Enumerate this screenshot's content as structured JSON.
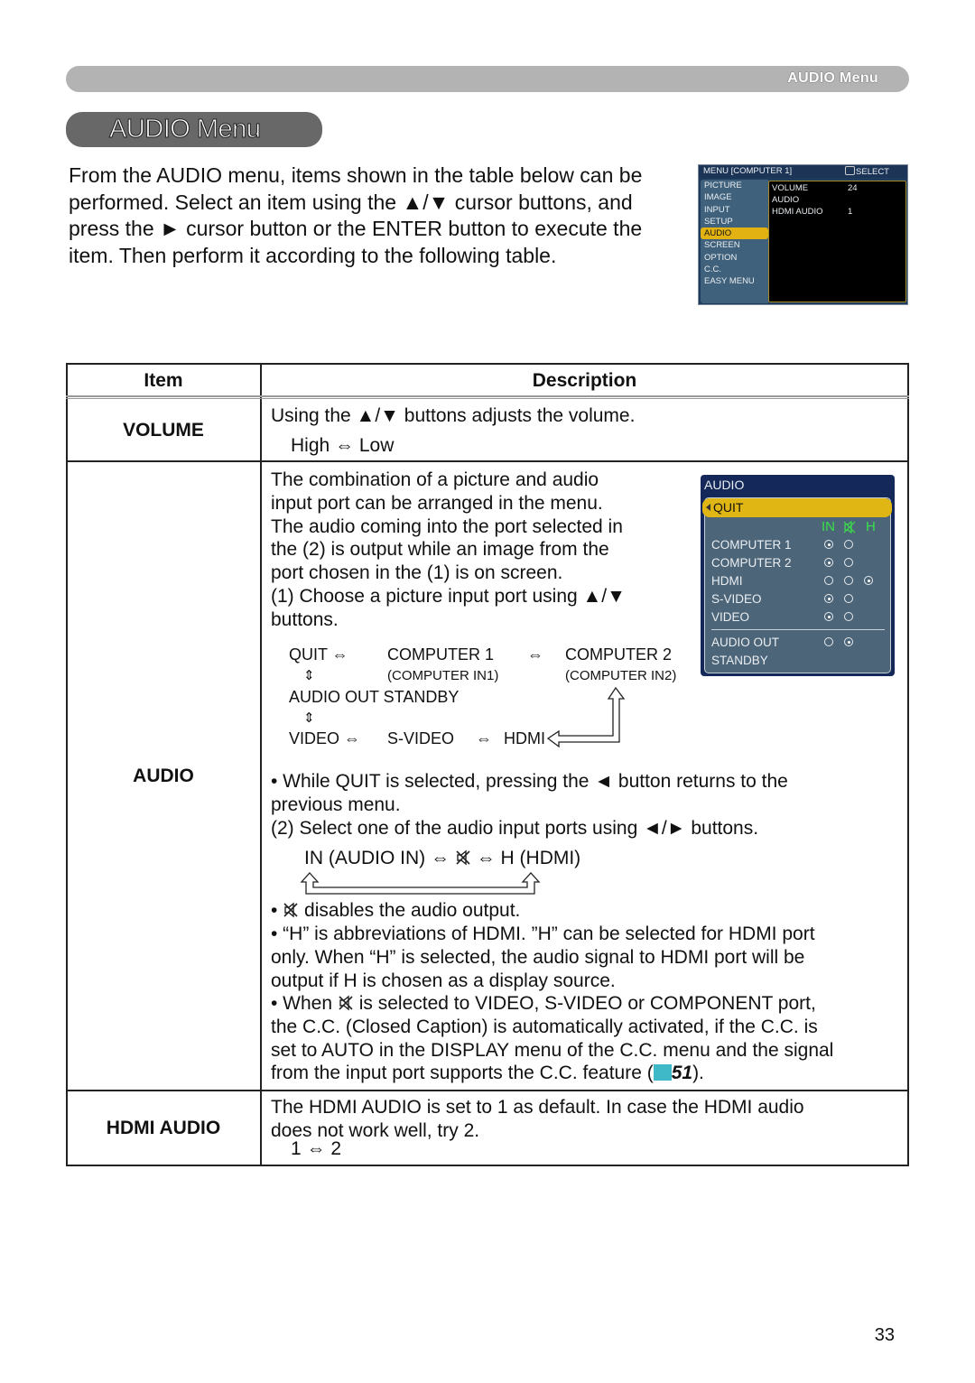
{
  "header": {
    "section_label": "AUDIO Menu"
  },
  "title": "AUDIO Menu",
  "intro": "From the AUDIO menu, items shown in the table below can be performed. Select an item using the ▲/▼ cursor buttons, and press the ► cursor button or the ENTER button to execute the item. Then perform it according to the following table.",
  "projector_menu": {
    "title": "MENU [COMPUTER 1]",
    "select_hint": "SELECT",
    "sidebar": [
      "PICTURE",
      "IMAGE",
      "INPUT",
      "SETUP",
      "AUDIO",
      "SCREEN",
      "OPTION",
      "C.C.",
      "EASY MENU"
    ],
    "selected": "AUDIO",
    "items": [
      {
        "label": "VOLUME",
        "value": "24"
      },
      {
        "label": "AUDIO",
        "value": ""
      },
      {
        "label": "HDMI AUDIO",
        "value": "1"
      }
    ],
    "colors": {
      "highlight": "#e2b212",
      "background": "#000000",
      "sidebar": "#40617b"
    }
  },
  "table": {
    "headers": {
      "item": "Item",
      "description": "Description"
    },
    "volume": {
      "item": "VOLUME",
      "line1": "Using the ▲/▼ buttons adjusts the volume.",
      "line2": "High ⇔ Low"
    },
    "audio": {
      "item": "AUDIO",
      "p1": [
        "The combination of a picture and audio",
        "input port can be arranged in the menu.",
        "The audio coming into the port selected in",
        "the (2) is output while an image from the",
        "port chosen in the (1) is on screen.",
        "(1) Choose a picture input port using ▲/▼",
        "buttons."
      ],
      "flow": {
        "quit": "QUIT ⇔",
        "computer1": "COMPUTER 1",
        "arrow1": "⇔",
        "computer2": "COMPUTER 2",
        "computer_in1": "(COMPUTER IN1)",
        "computer_in2": "(COMPUTER IN2)",
        "updown": "⇕",
        "audio_out_standby": "AUDIO OUT STANDBY",
        "video": "VIDEO ⇔",
        "svideo": "S-VIDEO",
        "arrow2": "⇔",
        "hdmi": "HDMI"
      },
      "p2": [
        "• While QUIT is selected, pressing the ◄ button returns to the",
        "previous menu.",
        "(2) Select one of the audio input ports using ◄/► buttons."
      ],
      "audio_flow": {
        "in": "IN (AUDIO IN) ⇔",
        "arrow": "⇔",
        "h": "H (HDMI)"
      },
      "notes": {
        "mute_prefix": "•",
        "mute_text": "disables the audio output.",
        "h_lines": [
          "• “H” is abbreviations of HDMI. ”H” can be selected for HDMI port",
          "only. When “H” is selected, the audio signal to HDMI port will be",
          "output if H is chosen as a display source."
        ],
        "when_prefix": "• When",
        "when_rest": "is selected to VIDEO, S-VIDEO or COMPONENT port,",
        "cc_lines": [
          "the C.C. (Closed Caption) is automatically activated, if the C.C. is",
          "set to AUTO in the DISPLAY menu of the C.C. menu and the signal"
        ],
        "last_prefix": "from the input port supports the C.C. feature (",
        "page_ref": "51",
        "last_suffix": ")."
      }
    },
    "hdmi_audio": {
      "item": "HDMI AUDIO",
      "line1": "The HDMI AUDIO is set to 1 as default. In case the HDMI audio",
      "line2": "does not work well, try 2.",
      "line3": "1 ⇔ 2"
    }
  },
  "audio_submenu": {
    "title": "AUDIO",
    "quit": "QUIT",
    "columns": [
      "IN",
      "mute",
      "H"
    ],
    "rows": [
      {
        "label": "COMPUTER 1",
        "states": [
          "on",
          "off"
        ]
      },
      {
        "label": "COMPUTER 2",
        "states": [
          "on",
          "off"
        ]
      },
      {
        "label": "HDMI",
        "states": [
          "off",
          "off",
          "on"
        ]
      },
      {
        "label": "S-VIDEO",
        "states": [
          "on",
          "off"
        ]
      },
      {
        "label": "VIDEO",
        "states": [
          "on",
          "off"
        ]
      }
    ],
    "audio_out": {
      "label1": "AUDIO OUT",
      "label2": "STANDBY",
      "states": [
        "off",
        "on"
      ]
    },
    "colors": {
      "column_header": "#38e04a",
      "highlight": "#e0b615"
    }
  },
  "page_number": "33"
}
